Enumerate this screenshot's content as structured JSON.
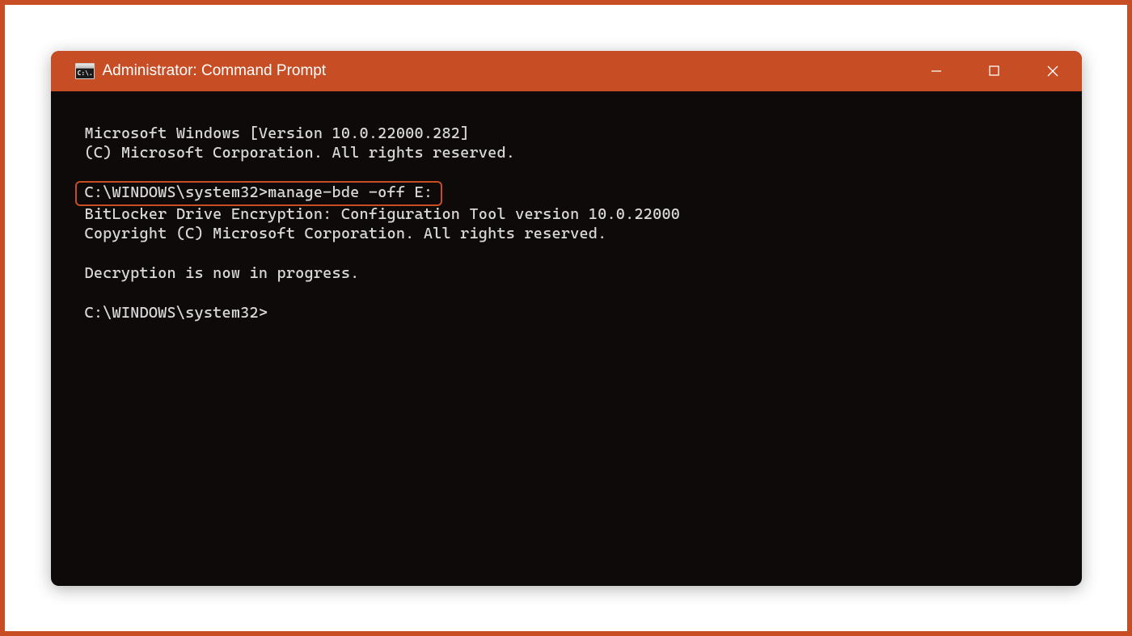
{
  "colors": {
    "accent": "#c74d24",
    "window_bg": "#0f0a0a",
    "text": "#d9d9d9"
  },
  "window": {
    "title": "Administrator: Command Prompt",
    "icon_text": "C:\\."
  },
  "terminal": {
    "line_version": "Microsoft Windows [Version 10.0.22000.282]",
    "line_copyright": "(C) Microsoft Corporation. All rights reserved.",
    "line_command": "C:\\WINDOWS\\system32>manage-bde -off E:",
    "line_tool": "BitLocker Drive Encryption: Configuration Tool version 10.0.22000",
    "line_tool_copyright": "Copyright (C) Microsoft Corporation. All rights reserved.",
    "line_status": "Decryption is now in progress.",
    "line_prompt": "C:\\WINDOWS\\system32>"
  }
}
